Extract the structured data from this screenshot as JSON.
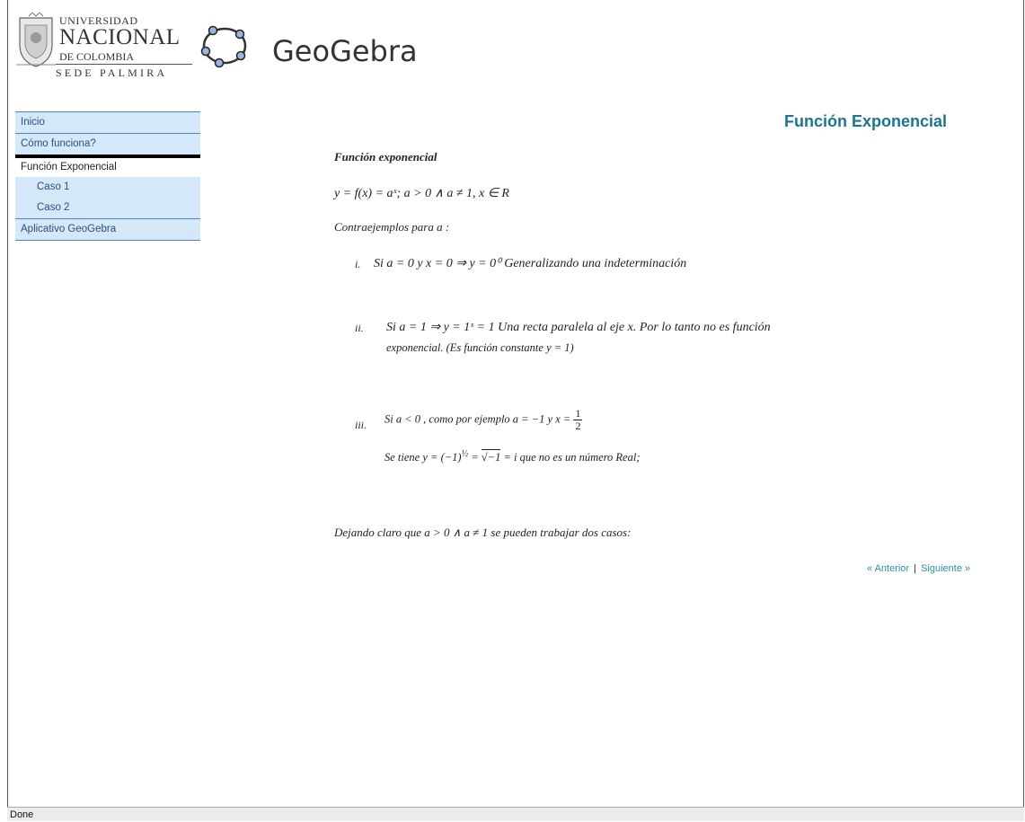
{
  "header": {
    "university": {
      "line1": "UNIVERSIDAD",
      "line2": "NACIONAL",
      "line3": "DE COLOMBIA",
      "line4": "SEDE PALMIRA"
    },
    "app_title": "GeoGebra"
  },
  "sidebar": {
    "items": [
      {
        "label": "Inicio"
      },
      {
        "label": "Cómo funciona?"
      },
      {
        "label": "Función Exponencial"
      },
      {
        "label": "Caso 1"
      },
      {
        "label": "Caso 2"
      },
      {
        "label": "Aplicativo GeoGebra"
      }
    ]
  },
  "main": {
    "page_heading": "Función Exponencial",
    "section_title": "Función exponencial",
    "definition": "y = f(x) = aˣ;    a > 0   ∧   a ≠ 1,   x ∈ R",
    "contra_intro": "Contraejemplos para a :",
    "case_i": {
      "numeral": "i.",
      "text": "Si  a = 0  y x = 0  ⇒  y = 0⁰ Generalizando una indeterminación"
    },
    "case_ii": {
      "numeral": "ii.",
      "line1": "Si  a = 1  ⇒  y = 1ˣ = 1  Una recta paralela al eje x. Por lo tanto no es función",
      "line2": "exponencial. (Es función constante y = 1)"
    },
    "case_iii": {
      "numeral": "iii.",
      "line1_prefix": "Si  a < 0  , como por ejemplo a = −1  y  x =",
      "frac_num": "1",
      "frac_den": "2",
      "line2_prefix": "Se tiene  y = (−1)",
      "line2_exp": "½",
      "line2_mid": " = ",
      "line2_sqrt": "√−1",
      "line2_suffix": " = i   que no es un número Real;"
    },
    "conclusion": "Dejando claro que a > 0   ∧   a ≠ 1 se pueden trabajar  dos casos:",
    "pager": {
      "prev": "« Anterior",
      "separator": "|",
      "next": "Siguiente »"
    }
  },
  "status_bar": {
    "text": "Done"
  },
  "colors": {
    "nav_bg": "#d5e8f9",
    "nav_border": "#4f86b8",
    "heading": "#1b7591",
    "link": "#2d8fa6"
  }
}
